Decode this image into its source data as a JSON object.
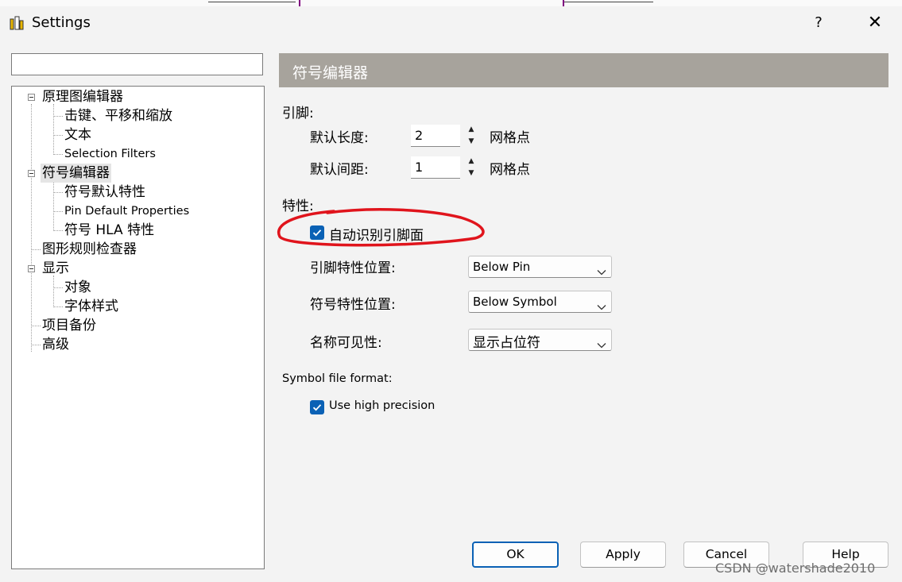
{
  "window": {
    "title": "Settings",
    "help": "?",
    "close": "✕"
  },
  "search": {
    "value": "",
    "placeholder": ""
  },
  "tree": [
    {
      "label": "原理图编辑器"
    },
    {
      "label": "击键、平移和缩放"
    },
    {
      "label": "文本"
    },
    {
      "label": "Selection Filters"
    },
    {
      "label": "符号编辑器",
      "selected": true
    },
    {
      "label": "符号默认特性"
    },
    {
      "label": "Pin Default Properties"
    },
    {
      "label": "符号 HLA 特性"
    },
    {
      "label": "图形规则检查器"
    },
    {
      "label": "显示"
    },
    {
      "label": "对象"
    },
    {
      "label": "字体样式"
    },
    {
      "label": "项目备份"
    },
    {
      "label": "高级"
    }
  ],
  "panel": {
    "title": "符号编辑器",
    "pins": {
      "label": "引脚:",
      "default_length": {
        "label": "默认长度:",
        "value": "2",
        "unit": "网格点"
      },
      "default_spacing": {
        "label": "默认间距:",
        "value": "1",
        "unit": "网格点"
      }
    },
    "properties": {
      "label": "特性:",
      "auto_detect": {
        "label": "自动识别引脚面",
        "checked": true
      },
      "pin_prop_position": {
        "label": "引脚特性位置:",
        "value": "Below Pin"
      },
      "symbol_prop_position": {
        "label": "符号特性位置:",
        "value": "Below Symbol"
      },
      "name_visibility": {
        "label": "名称可见性:",
        "value": "显示占位符"
      }
    },
    "file_format": {
      "label": "Symbol file format:",
      "high_precision": {
        "label": "Use high precision",
        "checked": true
      }
    }
  },
  "buttons": {
    "ok": "OK",
    "apply": "Apply",
    "cancel": "Cancel",
    "help": "Help"
  },
  "watermark": "CSDN @watershade2010",
  "colors": {
    "accent": "#0a61b5",
    "header": "#a7a39c",
    "annotation": "#e0141c"
  }
}
